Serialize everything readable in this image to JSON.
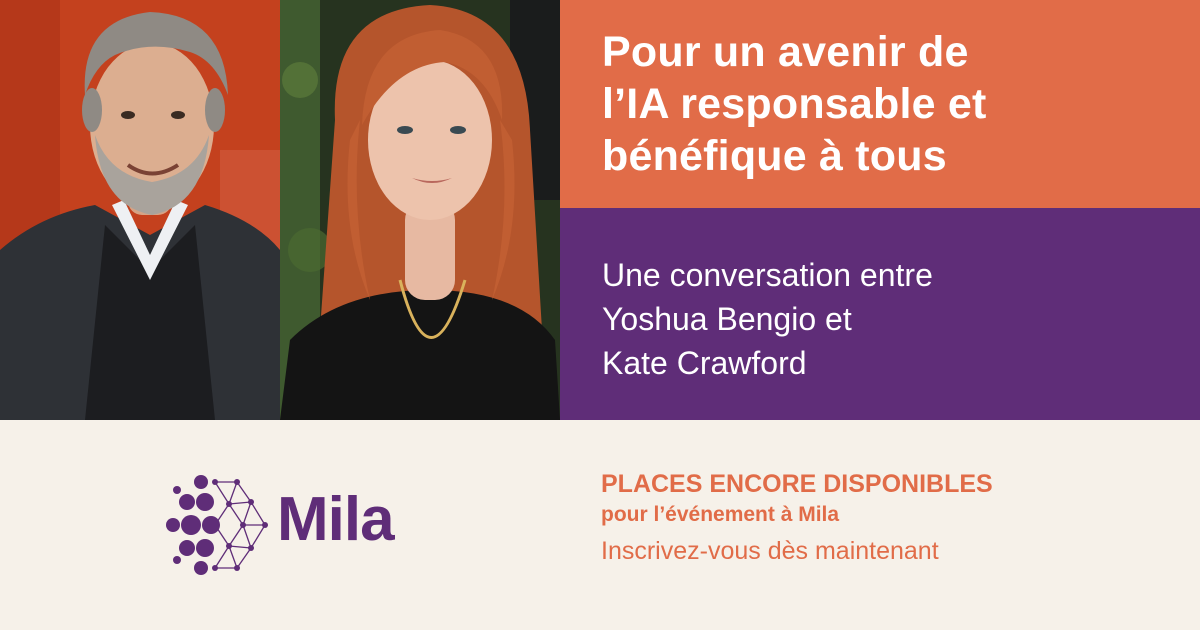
{
  "headline": {
    "lines": [
      "Pour un avenir de",
      "l’IA responsable et",
      "bénéfique à tous"
    ]
  },
  "conversation": {
    "lines": [
      "Une conversation entre",
      "Yoshua Bengio et",
      "Kate Crawford"
    ]
  },
  "logo": {
    "wordmark": "Mila",
    "icon": "neural-network-dots-icon"
  },
  "cta": {
    "line1": "PLACES ENCORE DISPONIBLES",
    "line2": "pour l’événement à Mila",
    "line3": "Inscrivez-vous dès maintenant"
  },
  "colors": {
    "orange": "#e16c48",
    "purple": "#5f2d78",
    "cream": "#f6f1e9",
    "white": "#ffffff"
  }
}
